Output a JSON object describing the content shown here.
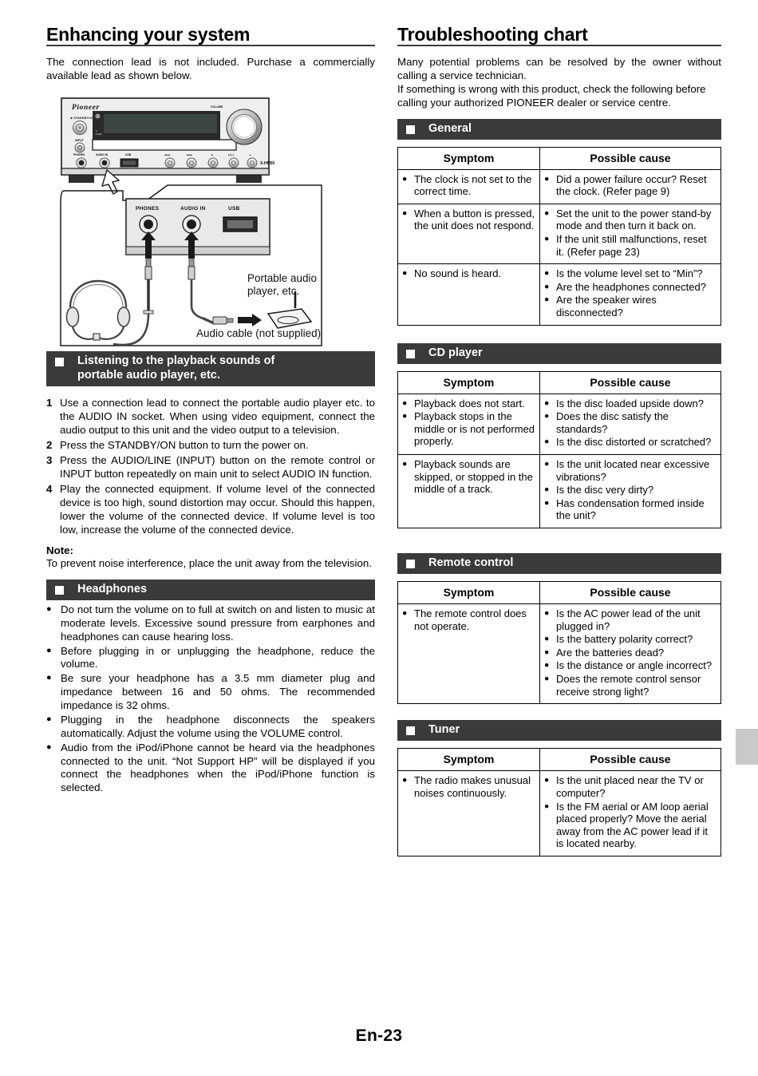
{
  "page": {
    "footer": "En-23",
    "edge_tab_color": "#c9c9c9"
  },
  "left_column": {
    "title": "Enhancing your system",
    "intro": "The connection lead is not included. Purchase a commercially available lead as shown below.",
    "figure": {
      "brand": "Pioneer",
      "model": "X-HM50",
      "front_panel_labels": {
        "standby": "STANDBY/ON",
        "input": "INPUT",
        "volume": "VOLUME",
        "phones": "PHONES",
        "audio_in": "AUDIO IN",
        "usb": "USB",
        "timer": "TIMER",
        "transport": [
          "|<< /<<",
          ">>/ >>|",
          "■",
          "▶/Ⅱ",
          "▲"
        ]
      },
      "callout_labels": {
        "phones": "PHONES",
        "audio_in": "AUDIO IN",
        "usb": "USB"
      },
      "caption_player": "Portable audio player, etc.",
      "caption_cable": "Audio cable (not supplied)"
    },
    "section_listening": {
      "bar_title_line1": "Listening to the playback sounds of",
      "bar_title_line2": "portable audio player, etc.",
      "steps": [
        {
          "num": "1",
          "text": "Use a connection lead to connect the portable audio player etc. to the AUDIO IN socket. When using video equipment, connect the audio output to this unit and the video output to a television."
        },
        {
          "num": "2",
          "text": "Press the STANDBY/ON button to turn the power on."
        },
        {
          "num": "3",
          "text": "Press the AUDIO/LINE (INPUT) button on the remote control or INPUT button repeatedly on main unit to select AUDIO IN function."
        },
        {
          "num": "4",
          "text": "Play the connected equipment. If volume level of the connected device is too high, sound distortion may occur. Should this happen, lower the volume of the connected device. If volume level is too low, increase the volume of the connected device."
        }
      ],
      "note_label": "Note:",
      "note_text": "To prevent noise interference, place the unit away from the television."
    },
    "section_headphones": {
      "bar_title": "Headphones",
      "bullets": [
        "Do not turn the volume on to full at switch on and listen to music at moderate levels. Excessive sound pressure from earphones and headphones can cause hearing loss.",
        "Before plugging in or unplugging the headphone, reduce the volume.",
        "Be sure your headphone has a 3.5 mm diameter plug and impedance between 16 and 50 ohms. The recommended impedance is 32 ohms.",
        "Plugging in the headphone disconnects the speakers automatically. Adjust the volume using the VOLUME control.",
        "Audio from the iPod/iPhone cannot be heard via the headphones connected to the unit. “Not Support HP” will be displayed if you connect the headphones when the iPod/iPhone function is selected."
      ]
    }
  },
  "right_column": {
    "title": "Troubleshooting chart",
    "intro_line1": "Many potential problems can be resolved by the owner without calling a service technician.",
    "intro_line2": "If something is wrong with this product, check the following before calling your authorized PIONEER dealer or service centre.",
    "table_headers": {
      "symptom": "Symptom",
      "cause": "Possible cause"
    },
    "sections": [
      {
        "bar_title": "General",
        "rows": [
          {
            "symptom": [
              "The clock is not set to the correct time."
            ],
            "cause": [
              "Did a power failure occur? Reset the clock. (Refer page 9)"
            ]
          },
          {
            "symptom": [
              "When a button is pressed, the unit does not respond."
            ],
            "cause": [
              "Set the unit to the power stand-by mode and then turn it back on.",
              "If the unit still malfunctions, reset it. (Refer page 23)"
            ]
          },
          {
            "symptom": [
              "No sound is heard."
            ],
            "cause": [
              "Is the volume level set to “Min”?",
              "Are the headphones connected?",
              "Are the speaker wires disconnected?"
            ]
          }
        ]
      },
      {
        "bar_title": "CD player",
        "rows": [
          {
            "symptom": [
              "Playback does not start.",
              "Playback stops in the middle or is not performed properly."
            ],
            "cause": [
              "Is the disc loaded upside down?",
              "Does the disc satisfy the standards?",
              "Is the disc distorted or scratched?"
            ]
          },
          {
            "symptom": [
              "Playback sounds are skipped, or stopped in the middle of a track."
            ],
            "cause": [
              "Is the unit located near excessive vibrations?",
              "Is the disc very dirty?",
              "Has condensation formed inside the unit?"
            ]
          }
        ]
      },
      {
        "bar_title": "Remote control",
        "rows": [
          {
            "symptom": [
              "The remote control does not operate."
            ],
            "cause": [
              "Is the AC power lead of the unit plugged in?",
              "Is the battery polarity correct?",
              "Are the batteries dead?",
              "Is the distance or angle incorrect?",
              "Does the remote control sensor receive strong light?"
            ]
          }
        ]
      },
      {
        "bar_title": "Tuner",
        "rows": [
          {
            "symptom": [
              "The radio makes unusual noises continuously."
            ],
            "cause": [
              "Is the unit placed near the TV or computer?",
              "Is the FM aerial or AM loop aerial placed properly? Move the aerial away from the AC power lead if it is located nearby."
            ]
          }
        ]
      }
    ]
  }
}
